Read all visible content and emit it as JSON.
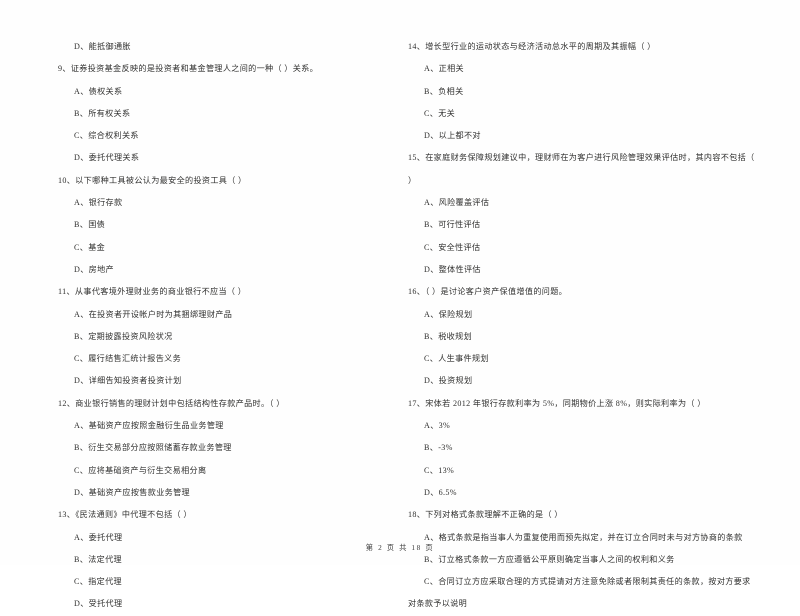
{
  "document": {
    "type": "exam-paper",
    "language": "zh-CN",
    "footer": "第 2 页 共 18 页"
  },
  "left_column": {
    "orphan_option": "D、能抵御通胀",
    "questions": [
      {
        "stem": "9、证券投资基金反映的是投资者和基金管理人之间的一种（       ）关系。",
        "options": [
          "A、债权关系",
          "B、所有权关系",
          "C、综合权利关系",
          "D、委托代理关系"
        ]
      },
      {
        "stem": "10、以下哪种工具被公认为最安全的投资工具（       ）",
        "options": [
          "A、银行存款",
          "B、国债",
          "C、基金",
          "D、房地产"
        ]
      },
      {
        "stem": "11、从事代客境外理财业务的商业银行不应当（       ）",
        "options": [
          "A、在投资者开设帐户时为其捆绑理财产品",
          "B、定期披露投资风险状况",
          "C、履行结售汇统计报告义务",
          "D、详细告知投资者投资计划"
        ]
      },
      {
        "stem": "12、商业银行销售的理财计划中包括结构性存款产品时。（       ）",
        "options": [
          "A、基础资产应按照金融衍生品业务管理",
          "B、衍生交易部分应按照储蓄存款业务管理",
          "C、应将基础资产与衍生交易相分离",
          "D、基础资产应按售款业务管理"
        ]
      },
      {
        "stem": "13、《民法通则》中代理不包括（       ）",
        "options": [
          "A、委托代理",
          "B、法定代理",
          "C、指定代理",
          "D、受托代理"
        ]
      }
    ]
  },
  "right_column": {
    "questions": [
      {
        "stem": "14、增长型行业的运动状态与经济活动总水平的周期及其振幅（       ）",
        "options": [
          "A、正相关",
          "B、负相关",
          "C、无关",
          "D、以上都不对"
        ]
      },
      {
        "stem": "15、在家庭财务保障规划建议中，理财师在为客户进行风险管理效果评估时，其内容不包括（",
        "stem_cont": "）",
        "options": [
          "A、风险覆盖评估",
          "B、可行性评估",
          "C、安全性评估",
          "D、整体性评估"
        ]
      },
      {
        "stem": "16、（       ）是讨论客户资产保值增值的问题。",
        "options": [
          "A、保险规划",
          "B、税收规划",
          "C、人生事件规划",
          "D、投资规划"
        ]
      },
      {
        "stem": "17、宋体若 2012 年银行存款利率为 5%，同期物价上涨 8%，则实际利率为（       ）",
        "options": [
          "A、3%",
          "B、-3%",
          "C、13%",
          "D、6.5%"
        ]
      },
      {
        "stem": "18、下列对格式条款理解不正确的是（       ）",
        "options": [
          "A、格式条款是指当事人为重复使用而预先拟定，并在订立合同时未与对方协商的条款",
          "B、订立格式条款一方应遵循公平原则确定当事人之间的权利和义务",
          "C、合同订立方应采取合理的方式提请对方注意免除或者限制其责任的条款，按对方要求"
        ],
        "option_cont": "对条款予以说明"
      }
    ]
  }
}
